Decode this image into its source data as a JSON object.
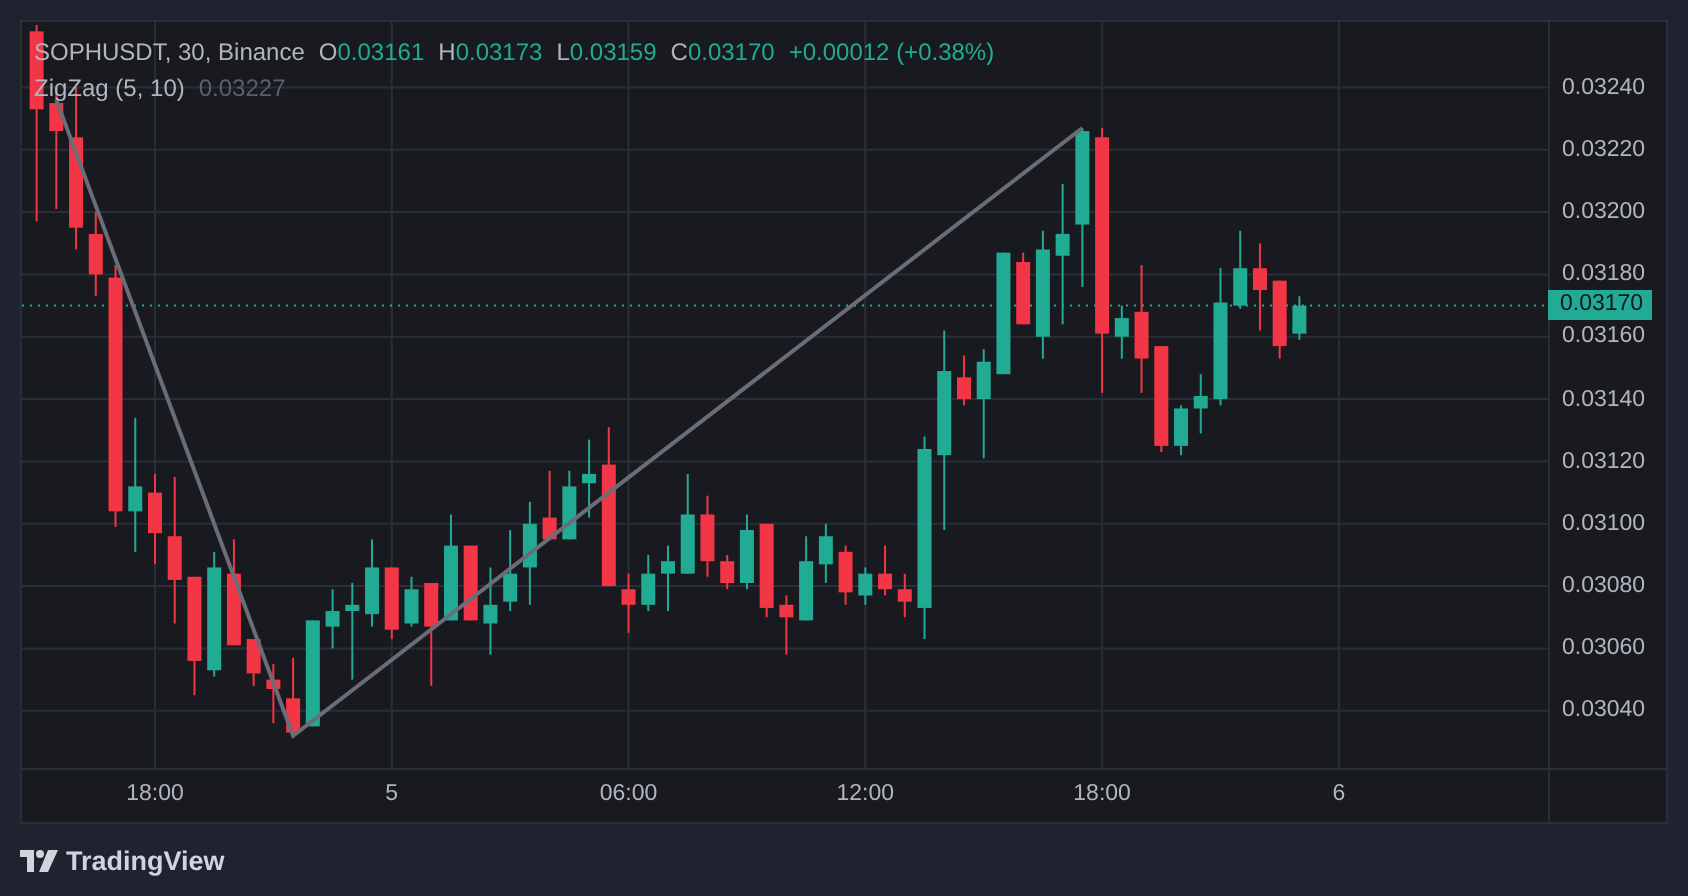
{
  "legend": {
    "symbol": "SOPHUSDT, 30, Binance",
    "fields": [
      {
        "label": "O",
        "value": "0.03161"
      },
      {
        "label": "H",
        "value": "0.03173"
      },
      {
        "label": "L",
        "value": "0.03159"
      },
      {
        "label": "C",
        "value": "0.03170"
      }
    ],
    "change": "+0.00012 (+0.38%)"
  },
  "indicator": {
    "name": "ZigZag (5, 10)",
    "value": "0.03227"
  },
  "price_axis": {
    "labels": [
      "0.03240",
      "0.03220",
      "0.03200",
      "0.03180",
      "0.03160",
      "0.03140",
      "0.03120",
      "0.03100",
      "0.03080",
      "0.03060",
      "0.03040"
    ],
    "current_price": "0.03170"
  },
  "time_axis": {
    "labels": [
      "18:00",
      "5",
      "06:00",
      "12:00",
      "18:00",
      "6"
    ]
  },
  "brand": {
    "name": "TradingView"
  }
}
